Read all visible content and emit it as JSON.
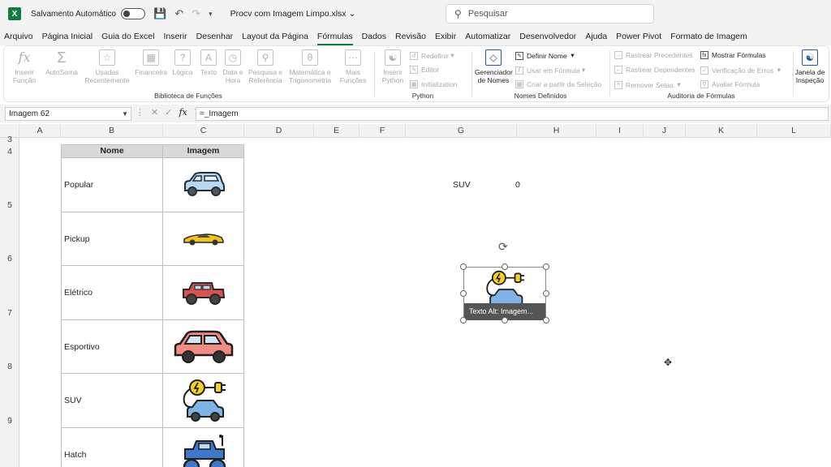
{
  "titlebar": {
    "autosave_label": "Salvamento Automático",
    "filename": "Procv com Imagem Limpo.xlsx",
    "search_placeholder": "Pesquisar"
  },
  "menu": [
    "Arquivo",
    "Página Inicial",
    "Guia do Excel",
    "Inserir",
    "Desenhar",
    "Layout da Página",
    "Fórmulas",
    "Dados",
    "Revisão",
    "Exibir",
    "Automatizar",
    "Desenvolvedor",
    "Ajuda",
    "Power Pivot",
    "Formato de Imagem"
  ],
  "menu_active": "Fórmulas",
  "ribbon": {
    "biblioteca": {
      "label": "Biblioteca de Funções",
      "inserir_funcao": "Inserir Função",
      "autosoma": "AutoSoma",
      "usadas": "Usadas Recentemente",
      "financeira": "Financeira",
      "logica": "Lógica",
      "texto": "Texto",
      "data_hora": "Data e Hora",
      "pesquisa": "Pesquisa e Referência",
      "matematica": "Matemática e Trigonometria",
      "mais": "Mais Funções"
    },
    "python": {
      "label": "Python",
      "inserir_python": "Inserir Python",
      "redefinir": "Redefinir",
      "editor": "Editor",
      "initialization": "Initialization"
    },
    "nomes": {
      "label": "Nomes Definidos",
      "gerenciador": "Gerenciador de Nomes",
      "definir": "Definir Nome",
      "usar": "Usar em Fórmula",
      "criar": "Criar a partir da Seleção"
    },
    "auditoria": {
      "label": "Auditoria de Fórmulas",
      "precedentes": "Rastrear Precedentes",
      "dependentes": "Rastrear Dependentes",
      "remover": "Remover Setas",
      "mostrar": "Mostrar Fórmulas",
      "verificacao": "Verificação de Erros",
      "avaliar": "Avaliar Fórmula",
      "janela": "Janela de Inspeção"
    }
  },
  "formula_bar": {
    "name_box": "Imagem 62",
    "formula": "=_Imagem"
  },
  "columns": [
    "A",
    "B",
    "C",
    "D",
    "E",
    "F",
    "G",
    "H",
    "I",
    "J",
    "K",
    "L"
  ],
  "rows": [
    "3",
    "4",
    "5",
    "6",
    "7",
    "8",
    "9"
  ],
  "table": {
    "header_nome": "Nome",
    "header_imagem": "Imagem",
    "rows": [
      {
        "nome": "Popular",
        "icon": "compact-car-icon"
      },
      {
        "nome": "Pickup",
        "icon": "sports-car-icon"
      },
      {
        "nome": "Elétrico",
        "icon": "jeep-icon"
      },
      {
        "nome": "Esportivo",
        "icon": "red-car-icon"
      },
      {
        "nome": "SUV",
        "icon": "electric-car-icon"
      },
      {
        "nome": "Hatch",
        "icon": "monster-truck-icon"
      }
    ]
  },
  "lookup": {
    "key": "SUV",
    "value": "0"
  },
  "selected_picture": {
    "alt_text": "Texto Alt: Imagem..."
  },
  "colors": {
    "excel_green": "#107c41",
    "header_fill": "#d9d9d9"
  }
}
